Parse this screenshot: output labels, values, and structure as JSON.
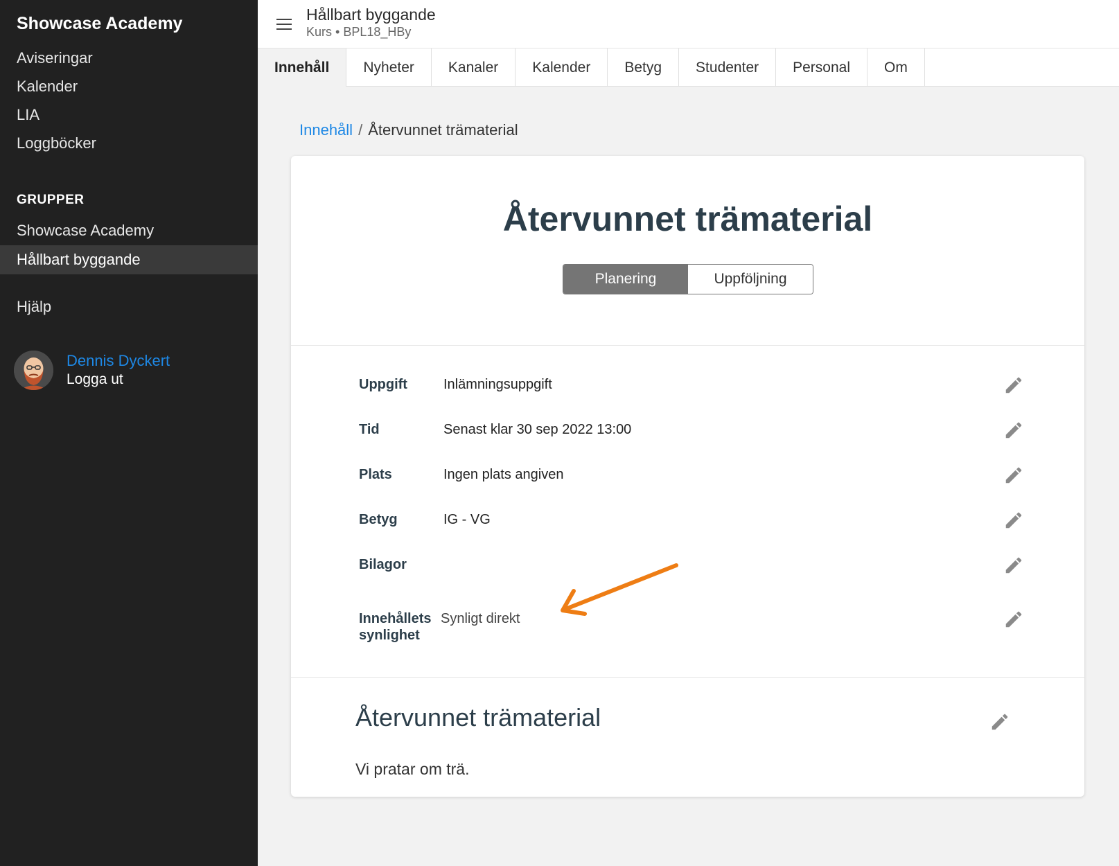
{
  "sidebar": {
    "brand": "Showcase Academy",
    "nav": [
      "Aviseringar",
      "Kalender",
      "LIA",
      "Loggböcker"
    ],
    "groups_heading": "GRUPPER",
    "groups": [
      "Showcase Academy",
      "Hållbart byggande"
    ],
    "help": "Hjälp",
    "user": {
      "name": "Dennis Dyckert",
      "logout": "Logga ut"
    }
  },
  "header": {
    "menu_icon": "hamburger-menu-icon",
    "title": "Hållbart byggande",
    "subtitle": "Kurs • BPL18_HBy"
  },
  "tabs": [
    "Innehåll",
    "Nyheter",
    "Kanaler",
    "Kalender",
    "Betyg",
    "Studenter",
    "Personal",
    "Om"
  ],
  "breadcrumb": {
    "root": "Innehåll",
    "separator": "/",
    "current": "Återvunnet trämaterial"
  },
  "content": {
    "title": "Återvunnet trämaterial",
    "toggle": {
      "planning": "Planering",
      "followup": "Uppföljning"
    },
    "details": [
      {
        "label": "Uppgift",
        "value": "Inlämningsuppgift"
      },
      {
        "label": "Tid",
        "value": "Senast klar 30 sep 2022 13:00"
      },
      {
        "label": "Plats",
        "value": "Ingen plats angiven"
      },
      {
        "label": "Betyg",
        "value": "IG - VG"
      },
      {
        "label": "Bilagor",
        "value": ""
      }
    ],
    "visibility": {
      "label_line1": "Innehållets",
      "label_line2": "synlighet",
      "value": "Synligt direkt"
    },
    "section": {
      "title": "Återvunnet trämaterial",
      "text": "Vi pratar om trä."
    }
  },
  "colors": {
    "sidebar_bg": "#212121",
    "link": "#1e88e5",
    "annotation_arrow": "#ee7d14",
    "toggle_active": "#757575"
  }
}
